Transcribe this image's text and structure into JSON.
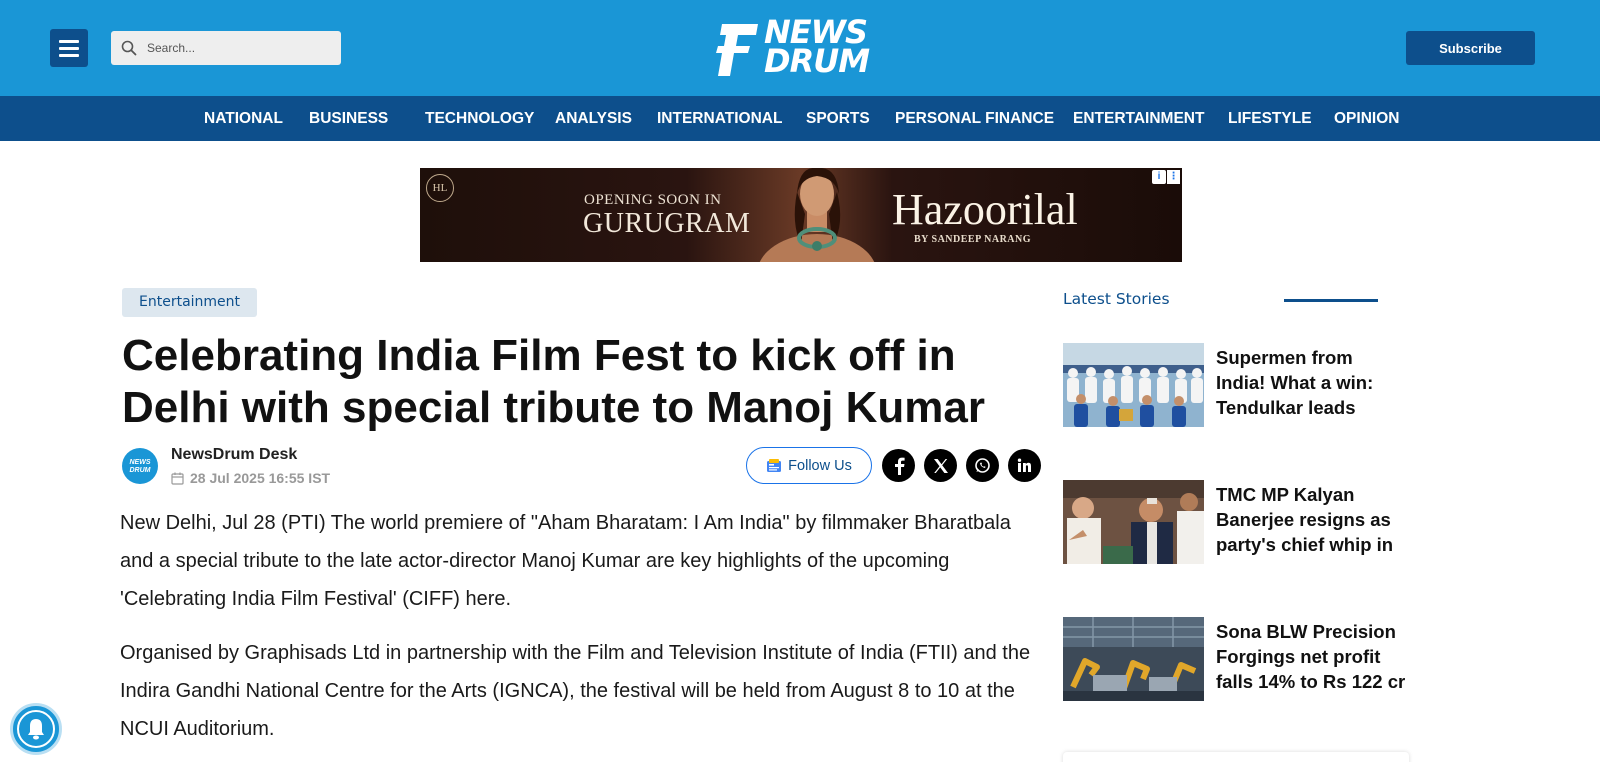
{
  "header": {
    "search_placeholder": "Search...",
    "logo_line1": "NEWS",
    "logo_line2": "DRUM",
    "subscribe_label": "Subscribe",
    "brand_color": "#1a96d6",
    "nav_color": "#0d4f8c"
  },
  "nav": {
    "items": [
      {
        "label": "NATIONAL"
      },
      {
        "label": "BUSINESS"
      },
      {
        "label": "TECHNOLOGY"
      },
      {
        "label": "ANALYSIS"
      },
      {
        "label": "INTERNATIONAL"
      },
      {
        "label": "SPORTS"
      },
      {
        "label": "PERSONAL FINANCE"
      },
      {
        "label": "ENTERTAINMENT"
      },
      {
        "label": "LIFESTYLE"
      },
      {
        "label": "OPINION"
      }
    ]
  },
  "ad": {
    "monogram": "HL",
    "opening": "OPENING SOON IN",
    "city": "GURUGRAM",
    "brand": "Hazoorilal",
    "byline": "BY SANDEEP NARANG"
  },
  "article": {
    "category": "Entertainment",
    "headline": "Celebrating India Film Fest to kick off in Delhi with special tribute to Manoj Kumar",
    "author": "NewsDrum Desk",
    "avatar_text": "NEWS DRUM",
    "date": "28 Jul 2025 16:55 IST",
    "follow_label": "Follow Us",
    "paragraphs": [
      "New Delhi, Jul 28 (PTI) The world premiere of \"Aham Bharatam: I Am India\" by filmmaker Bharatbala and a special tribute to the late actor-director Manoj Kumar are key highlights of the upcoming 'Celebrating India Film Festival' (CIFF) here.",
      "Organised by Graphisads Ltd in partnership with the Film and Television Institute of India (FTII) and the Indira Gandhi National Centre for the Arts (IGNCA), the festival will be held from August 8 to 10 at the NCUI Auditorium."
    ]
  },
  "sidebar": {
    "title": "Latest Stories",
    "stories": [
      {
        "title": "Supermen from India! What a win: Tendulkar leads"
      },
      {
        "title": "TMC MP Kalyan Banerjee resigns as party's chief whip in"
      },
      {
        "title": "Sona BLW Precision Forgings net profit falls 14% to Rs 122 cr"
      }
    ]
  }
}
